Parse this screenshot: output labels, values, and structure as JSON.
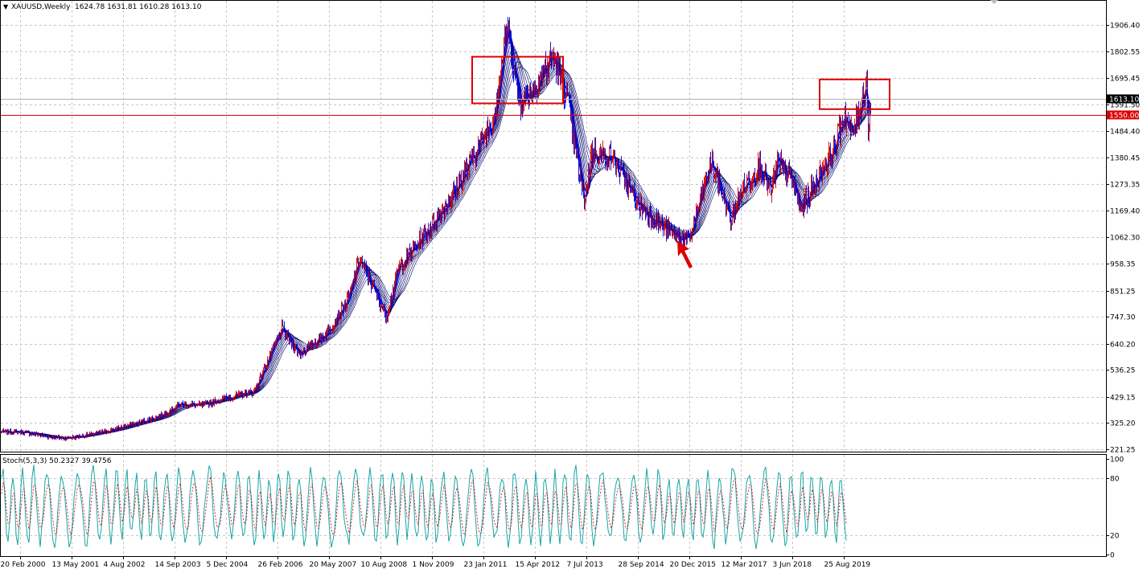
{
  "header": {
    "symbol_label": "XAUUSD,Weekly",
    "ohlc": "1624.78 1631.81 1610.28 1613.10"
  },
  "indicator": {
    "label": "Stoch(5,3,3) 50.2327 39.4756",
    "levels": [
      "100",
      "80",
      "20",
      "0"
    ]
  },
  "colors": {
    "bull_candle": "#cc0000",
    "bear_candle": "#0000cc",
    "ribbon": "#000066",
    "fast_ribbon": "#0000cc",
    "support_line": "#dd0000",
    "highlight_box": "#dd0000",
    "arrow": "#dd0000",
    "stoch_main": "#1aa5a5",
    "stoch_signal": "#cc0000",
    "grid": "#c8c8c8"
  },
  "chart_data": {
    "type": "line",
    "title": "XAUUSD,Weekly",
    "price_ticks": [
      "1906.40",
      "1802.55",
      "1695.45",
      "1591.50",
      "1484.40",
      "1380.45",
      "1273.35",
      "1169.40",
      "1062.30",
      "958.35",
      "851.25",
      "747.30",
      "640.20",
      "536.25",
      "429.15",
      "325.20",
      "221.25"
    ],
    "current_price": "1613.10",
    "horizontal_level": "1550.00",
    "date_ticks": [
      "20 Feb 2000",
      "13 May 2001",
      "4 Aug 2002",
      "14 Sep 2003",
      "5 Dec 2004",
      "26 Feb 2006",
      "20 May 2007",
      "10 Aug 2008",
      "1 Nov 2009",
      "23 Jan 2011",
      "15 Apr 2012",
      "7 Jul 2013",
      "28 Sep 2014",
      "20 Dec 2015",
      "12 Mar 2017",
      "3 Jun 2018",
      "25 Aug 2019"
    ],
    "price_path": [
      [
        "2000-02-20",
        290
      ],
      [
        "2001-02-01",
        265
      ],
      [
        "2001-05-13",
        268
      ],
      [
        "2002-01-01",
        285
      ],
      [
        "2002-08-04",
        310
      ],
      [
        "2003-06-01",
        350
      ],
      [
        "2003-12-01",
        400
      ],
      [
        "2004-06-01",
        395
      ],
      [
        "2005-01-01",
        425
      ],
      [
        "2005-09-01",
        450
      ],
      [
        "2006-05-01",
        700
      ],
      [
        "2006-10-01",
        600
      ],
      [
        "2007-05-20",
        680
      ],
      [
        "2007-12-01",
        820
      ],
      [
        "2008-03-01",
        980
      ],
      [
        "2008-10-20",
        750
      ],
      [
        "2009-02-01",
        940
      ],
      [
        "2009-11-01",
        1100
      ],
      [
        "2010-06-01",
        1240
      ],
      [
        "2010-12-01",
        1400
      ],
      [
        "2011-05-01",
        1530
      ],
      [
        "2011-09-05",
        1900
      ],
      [
        "2011-12-15",
        1600
      ],
      [
        "2012-04-15",
        1650
      ],
      [
        "2012-10-01",
        1780
      ],
      [
        "2013-02-01",
        1620
      ],
      [
        "2013-06-28",
        1200
      ],
      [
        "2013-09-01",
        1400
      ],
      [
        "2014-03-01",
        1380
      ],
      [
        "2014-09-28",
        1200
      ],
      [
        "2014-12-01",
        1170
      ],
      [
        "2015-07-20",
        1080
      ],
      [
        "2015-12-20",
        1050
      ],
      [
        "2016-07-01",
        1365
      ],
      [
        "2016-12-20",
        1130
      ],
      [
        "2017-03-12",
        1240
      ],
      [
        "2017-09-01",
        1350
      ],
      [
        "2017-12-01",
        1240
      ],
      [
        "2018-01-25",
        1360
      ],
      [
        "2018-06-03",
        1290
      ],
      [
        "2018-08-15",
        1170
      ],
      [
        "2019-01-01",
        1290
      ],
      [
        "2019-06-01",
        1420
      ],
      [
        "2019-09-01",
        1550
      ],
      [
        "2019-11-01",
        1460
      ],
      [
        "2020-01-01",
        1560
      ],
      [
        "2020-03-09",
        1700
      ],
      [
        "2020-03-20",
        1480
      ],
      [
        "2020-04-15",
        1613
      ]
    ],
    "annotations": [
      "top-box-2011-2012",
      "top-box-2020",
      "arrow-low-dec-2015"
    ]
  }
}
